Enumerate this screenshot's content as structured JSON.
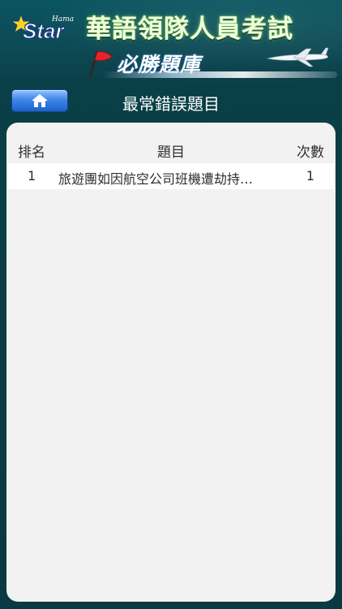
{
  "header": {
    "brand": "Star",
    "brand_script": "Hama",
    "title": "華語領隊人員考試",
    "subtitle": "必勝題庫"
  },
  "nav": {
    "home_icon": "home-icon",
    "title": "最常錯誤題目"
  },
  "table": {
    "columns": [
      "排名",
      "題目",
      "次數"
    ],
    "rows": [
      {
        "rank": "1",
        "question": "旅遊團如因航空公司班機遭劫持…",
        "count": "1"
      }
    ]
  },
  "colors": {
    "background": "#0a3f47",
    "panel": "#f2f2f2",
    "home_button": "#3f86e8",
    "title_glow": "#7fd06b"
  }
}
